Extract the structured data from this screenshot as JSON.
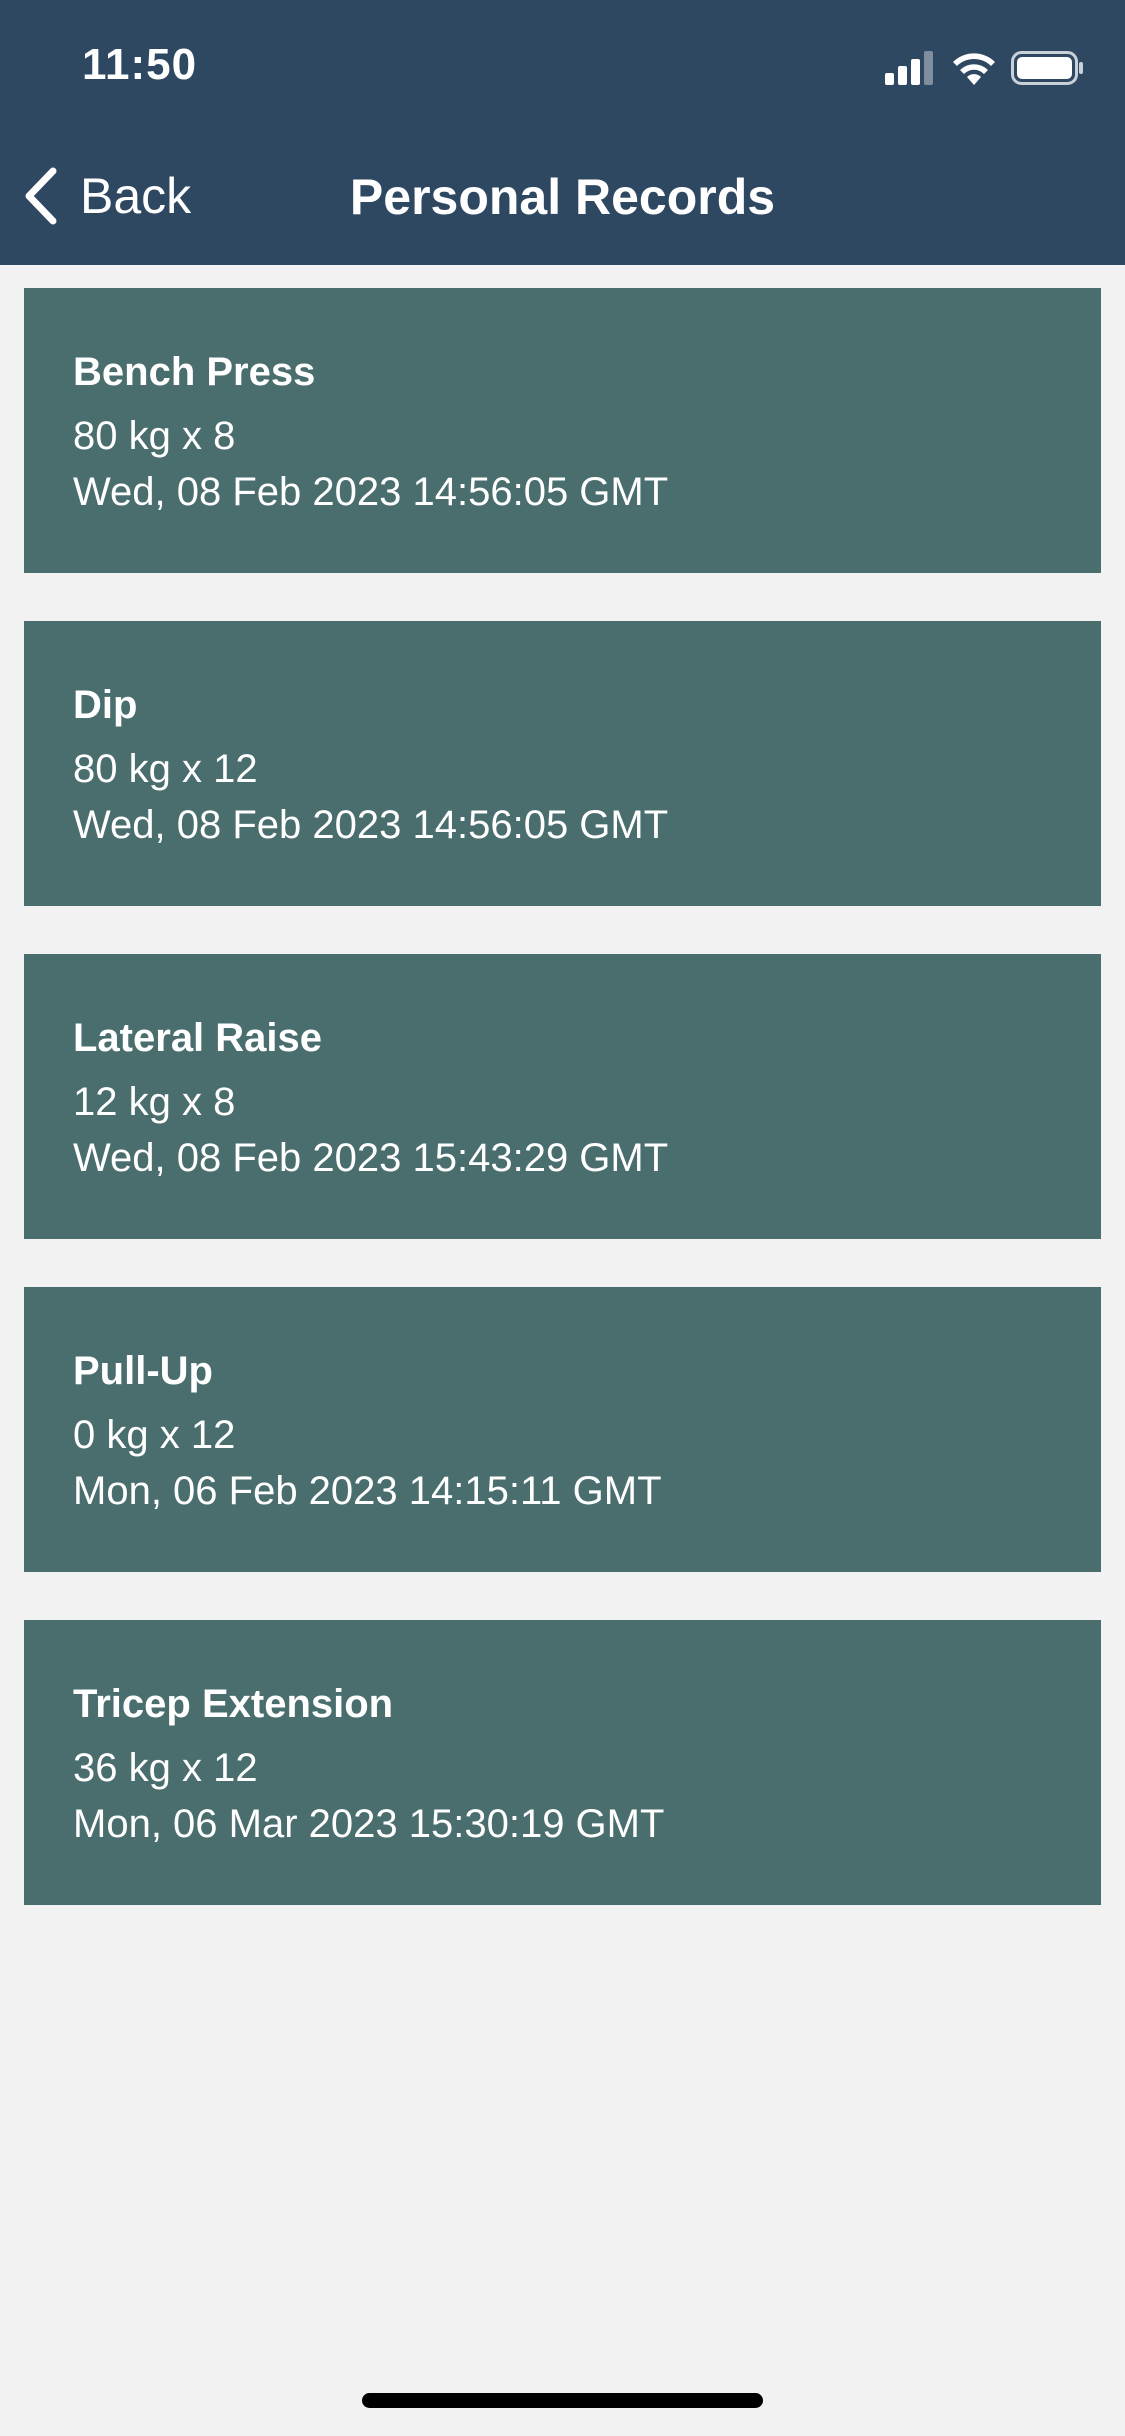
{
  "status_bar": {
    "time": "11:50",
    "icons": [
      "cellular-signal-icon",
      "wifi-icon",
      "battery-icon"
    ]
  },
  "nav": {
    "back_label": "Back",
    "title": "Personal Records"
  },
  "records": [
    {
      "name": "Bench Press",
      "detail": "80 kg x 8",
      "date": "Wed, 08 Feb 2023 14:56:05 GMT"
    },
    {
      "name": "Dip",
      "detail": "80 kg x 12",
      "date": "Wed, 08 Feb 2023 14:56:05 GMT"
    },
    {
      "name": "Lateral Raise",
      "detail": "12 kg x 8",
      "date": "Wed, 08 Feb 2023 15:43:29 GMT"
    },
    {
      "name": "Pull-Up",
      "detail": "0 kg x 12",
      "date": "Mon, 06 Feb 2023 14:15:11 GMT"
    },
    {
      "name": "Tricep Extension",
      "detail": "36 kg x 12",
      "date": "Mon, 06 Mar 2023 15:30:19 GMT"
    }
  ],
  "colors": {
    "header": "#2e4862",
    "card": "#4a6d6e",
    "background": "#f2f2f2"
  }
}
